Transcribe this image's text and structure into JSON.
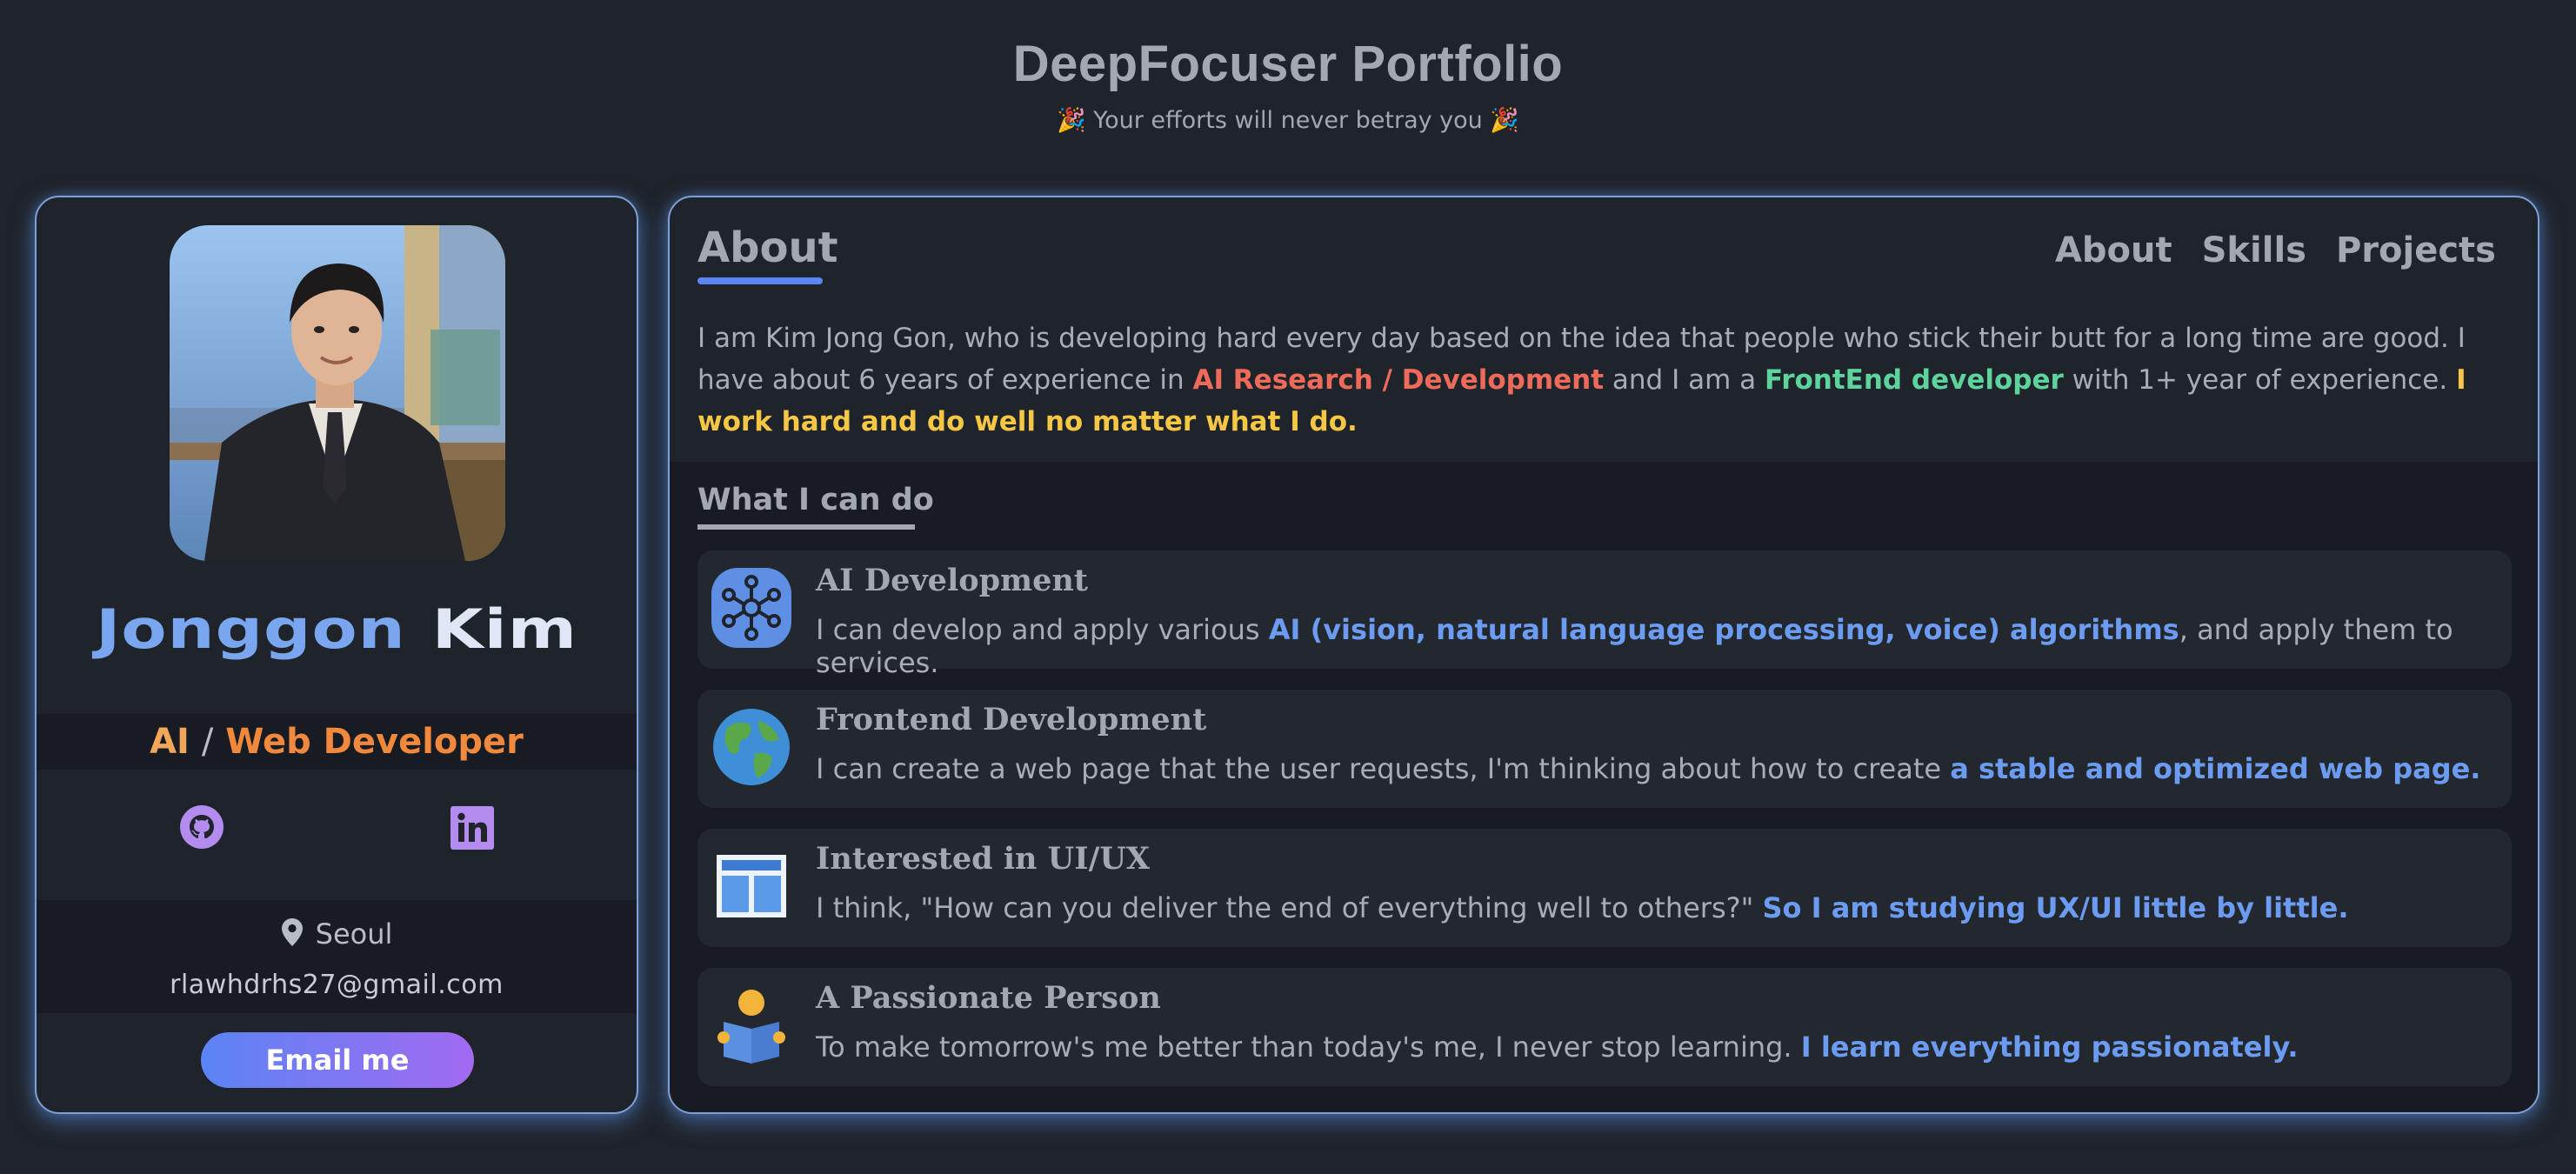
{
  "header": {
    "title": "DeepFocuser Portfolio",
    "subtitle": "🎉 Your efforts will never betray you 🎉"
  },
  "profile": {
    "first_name": "Jonggon",
    "last_name": "Kim",
    "role_ai": "AI",
    "role_sep": "/",
    "role_web": "Web Developer",
    "location": "Seoul",
    "email": "rlawhdrhs27@gmail.com",
    "email_button": "Email me",
    "icons": [
      "github-icon",
      "linkedin-icon",
      "location-pin-icon"
    ]
  },
  "about": {
    "title": "About",
    "nav": [
      "About",
      "Skills",
      "Projects"
    ],
    "intro": {
      "p1": "I am Kim Jong Gon, who is developing hard every day based on the idea that people who stick their butt for a long time are good. I have about 6 years of experience in ",
      "h1": "AI Research / Development",
      "p2": " and I am a ",
      "h2": "FrontEnd developer",
      "p3": " with 1+ year of experience. ",
      "h3": "I work hard and do well no matter what I do."
    }
  },
  "cando": {
    "title": "What I can do",
    "items": [
      {
        "icon": "network-icon",
        "title": "AI Development",
        "pre": "I can develop and apply various ",
        "hl": "AI (vision, natural language processing, voice) algorithms",
        "post": ", and apply them to services."
      },
      {
        "icon": "globe-icon",
        "title": "Frontend Development",
        "pre": "I can create a web page that the user requests, I'm thinking about how to create ",
        "hl": "a stable and optimized web page.",
        "post": ""
      },
      {
        "icon": "layout-icon",
        "title": "Interested in UI/UX",
        "pre": "I think, \"How can you deliver the end of everything well to others?\" ",
        "hl": "So I am studying UX/UI little by little.",
        "post": ""
      },
      {
        "icon": "reader-icon",
        "title": "A Passionate Person",
        "pre": "To make tomorrow's me better than today's me, I never stop learning. ",
        "hl": "I learn everything passionately.",
        "post": ""
      }
    ]
  },
  "colors": {
    "background": "#1f232a",
    "border": "#7ea0d8",
    "accent_blue": "#6b9cf2",
    "accent_red": "#ee6b5b",
    "accent_green": "#5dd39e",
    "accent_yellow": "#f6c744",
    "accent_orange": "#f0883e"
  }
}
